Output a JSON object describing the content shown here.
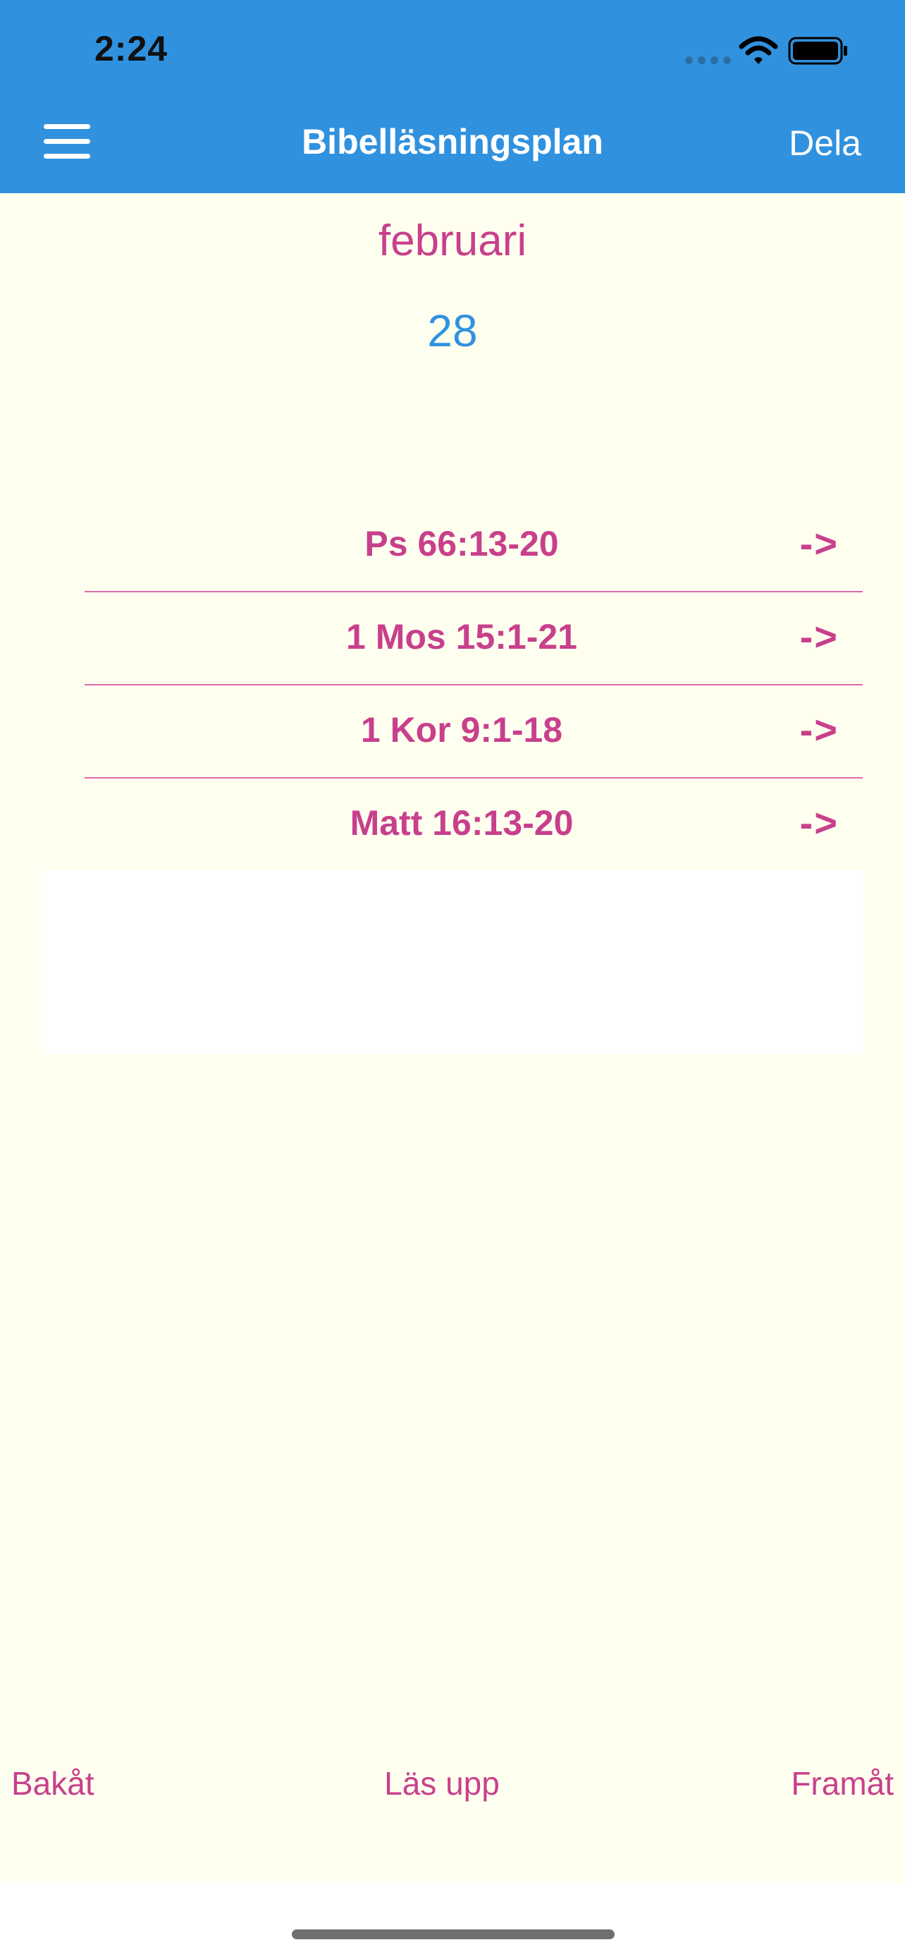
{
  "status_bar": {
    "time": "2:24"
  },
  "header": {
    "title": "Bibelläsningsplan",
    "share_label": "Dela",
    "menu_icon": "hamburger-menu-icon",
    "background_color": "#3092df"
  },
  "date": {
    "month": "februari",
    "day": "28"
  },
  "readings": [
    {
      "reference": "Ps 66:13-20",
      "arrow": "->"
    },
    {
      "reference": "1 Mos 15:1-21",
      "arrow": "->"
    },
    {
      "reference": "1 Kor 9:1-18",
      "arrow": "->"
    },
    {
      "reference": "Matt 16:13-20",
      "arrow": "->"
    }
  ],
  "bottom_nav": {
    "back_label": "Bakåt",
    "read_label": "Läs upp",
    "forward_label": "Framåt"
  },
  "colors": {
    "accent": "#c8408c",
    "background": "#fffff0",
    "date_number": "#3092df",
    "divider": "#e06aae"
  }
}
